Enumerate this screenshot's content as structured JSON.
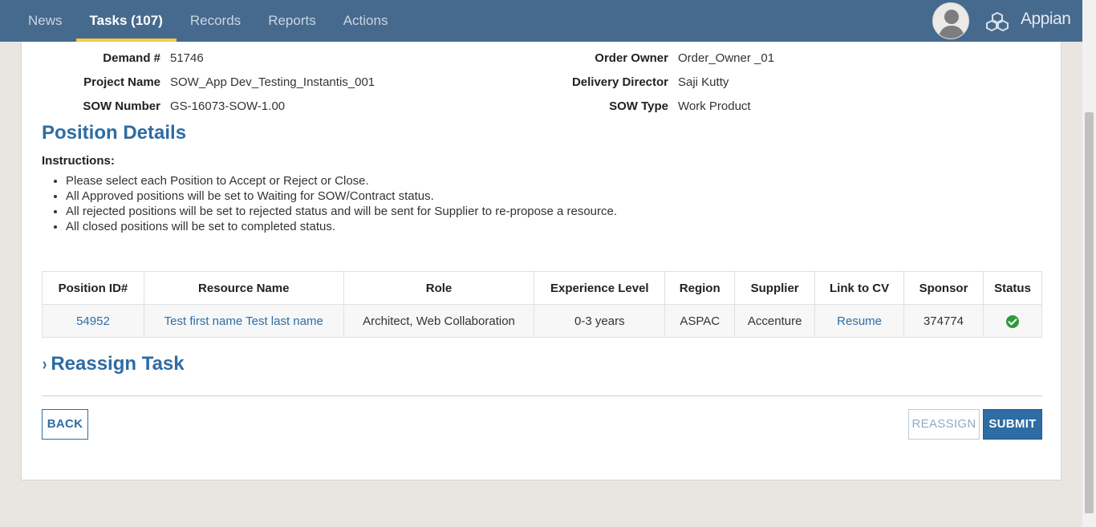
{
  "nav": {
    "items": [
      {
        "label": "News",
        "active": false
      },
      {
        "label": "Tasks (107)",
        "active": true
      },
      {
        "label": "Records",
        "active": false
      },
      {
        "label": "Reports",
        "active": false
      },
      {
        "label": "Actions",
        "active": false
      }
    ],
    "brand": "Appian"
  },
  "summary": {
    "demand_label": "Demand #",
    "demand_value": "51746",
    "project_label": "Project Name",
    "project_value": "SOW_App Dev_Testing_Instantis_001",
    "sow_number_label": "SOW Number",
    "sow_number_value": "GS-16073-SOW-1.00",
    "order_owner_label": "Order Owner",
    "order_owner_value": "Order_Owner _01",
    "delivery_director_label": "Delivery Director",
    "delivery_director_value": "Saji Kutty",
    "sow_type_label": "SOW Type",
    "sow_type_value": "Work Product"
  },
  "position_details": {
    "title": "Position Details",
    "instructions_label": "Instructions:",
    "instructions": [
      "Please select each Position to Accept or Reject or Close.",
      "All Approved positions will be set to Waiting for SOW/Contract status.",
      "All rejected positions will be set to rejected status and will be sent for Supplier to re-propose a resource.",
      "All closed positions will be set to completed status."
    ]
  },
  "table": {
    "headers": [
      "Position ID#",
      "Resource Name",
      "Role",
      "Experience Level",
      "Region",
      "Supplier",
      "Link to CV",
      "Sponsor",
      "Status"
    ],
    "rows": [
      {
        "position_id": "54952",
        "resource_name": "Test first name Test last name",
        "role": "Architect, Web Collaboration",
        "experience": "0-3 years",
        "region": "ASPAC",
        "supplier": "Accenture",
        "cv_link": "Resume",
        "sponsor": "374774",
        "status_icon": "check-circle-icon"
      }
    ]
  },
  "reassign": {
    "title": "Reassign Task",
    "chevron": "›"
  },
  "buttons": {
    "back": "BACK",
    "reassign": "REASSIGN",
    "submit": "SUBMIT"
  },
  "colors": {
    "header_bg": "#466a8e",
    "accent": "#2e6ca4",
    "active_underline": "#f4cb46",
    "status_ok": "#2e9a3c"
  }
}
